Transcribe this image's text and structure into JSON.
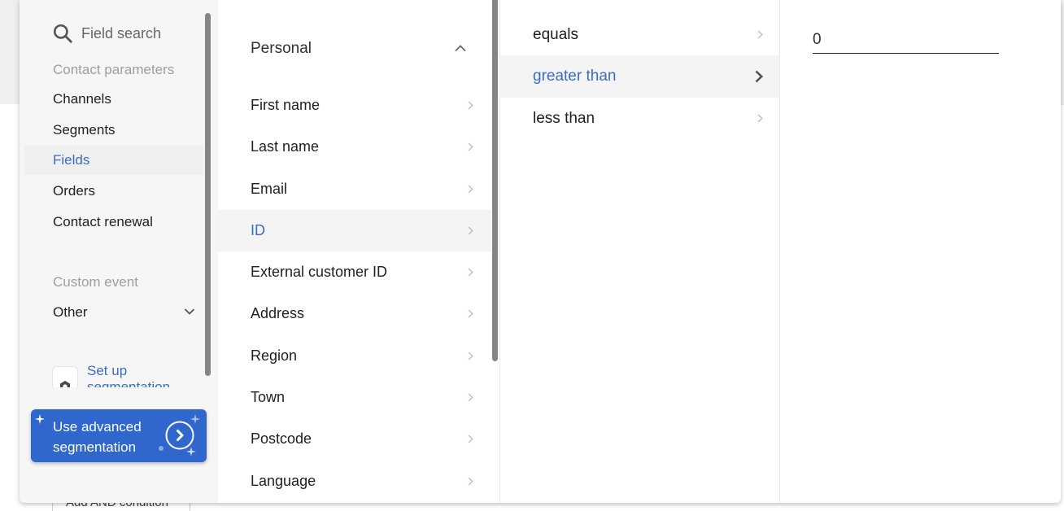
{
  "background": {
    "add_condition_label": "Add AND condition"
  },
  "sidebar": {
    "search": {
      "placeholder": "Field search",
      "value": "",
      "icon": "search-icon"
    },
    "groups": [
      {
        "label": "Contact parameters",
        "items": [
          {
            "label": "Channels",
            "active": false
          },
          {
            "label": "Segments",
            "active": false
          },
          {
            "label": "Fields",
            "active": true
          },
          {
            "label": "Orders",
            "active": false
          },
          {
            "label": "Contact renewal",
            "active": false
          }
        ]
      },
      {
        "label": "Custom event",
        "items": [
          {
            "label": "Other",
            "active": false,
            "expandable": true,
            "icon": "chevron-down-icon"
          }
        ]
      }
    ],
    "setup_link": {
      "label": "Set up segmentation",
      "icon": "gear-icon"
    },
    "advanced_button": {
      "label": "Use advanced segmentation",
      "icon": "chevron-right-circle-icon"
    }
  },
  "fields": {
    "group": {
      "label": "Personal",
      "expanded": true,
      "icon": "chevron-up-icon"
    },
    "items": [
      {
        "label": "First name",
        "active": false
      },
      {
        "label": "Last name",
        "active": false
      },
      {
        "label": "Email",
        "active": false
      },
      {
        "label": "ID",
        "active": true
      },
      {
        "label": "External customer ID",
        "active": false
      },
      {
        "label": "Address",
        "active": false
      },
      {
        "label": "Region",
        "active": false
      },
      {
        "label": "Town",
        "active": false
      },
      {
        "label": "Postcode",
        "active": false
      },
      {
        "label": "Language",
        "active": false
      }
    ]
  },
  "operators": {
    "items": [
      {
        "label": "equals",
        "active": false
      },
      {
        "label": "greater than",
        "active": true
      },
      {
        "label": "less than",
        "active": false
      }
    ]
  },
  "value": {
    "input_value": "0"
  },
  "colors": {
    "accent": "#3a6cc4",
    "button_bg": "#2f67cc",
    "sidebar_bg": "#f6f6f6",
    "muted_label": "#9e9e9e"
  }
}
